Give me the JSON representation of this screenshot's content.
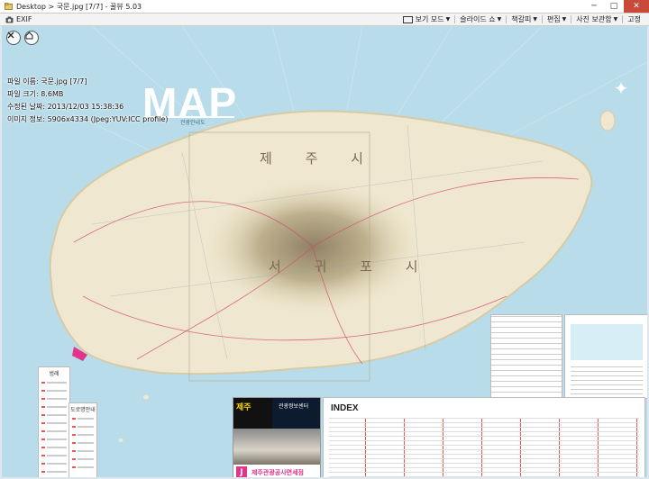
{
  "titlebar": {
    "title": "Desktop > 국문.jpg [7/7] - 꿀뷰 5.03",
    "minimize": "─",
    "maximize": "□",
    "close": "✕"
  },
  "toolbar": {
    "exif_label": "EXIF",
    "menu": [
      {
        "label": "보기 모드"
      },
      {
        "label": "슬라이드 쇼"
      },
      {
        "label": "책갈피"
      },
      {
        "label": "편집"
      },
      {
        "label": "사진 보관함"
      },
      {
        "label": "고정"
      }
    ]
  },
  "info": {
    "filename": "파일 이름: 국문.jpg [7/7]",
    "filesize": "파일 크기: 8.6MB",
    "modified": "수정된 날짜: 2013/12/03 15:38:36",
    "imageinfo": "이미지 정보: 5906x4334 (Jpeg:YUV:ICC profile)"
  },
  "map": {
    "title": "MAP",
    "subtitle": "관광안내도",
    "city_north": "제 주 시",
    "city_south": "서 귀 포 시",
    "index_title": "INDEX",
    "legend_title": "범례",
    "legend2_title": "도로명안내",
    "ad_line1": "제주",
    "ad_line2": "관광정보센터",
    "ad_logo": "J",
    "ad_bottom": "제주관광공사면세점"
  },
  "colors": {
    "sea": "#b8dcea",
    "land": "#efe7cf",
    "mountain": "#9b8e6e",
    "accent": "#e4338b"
  }
}
